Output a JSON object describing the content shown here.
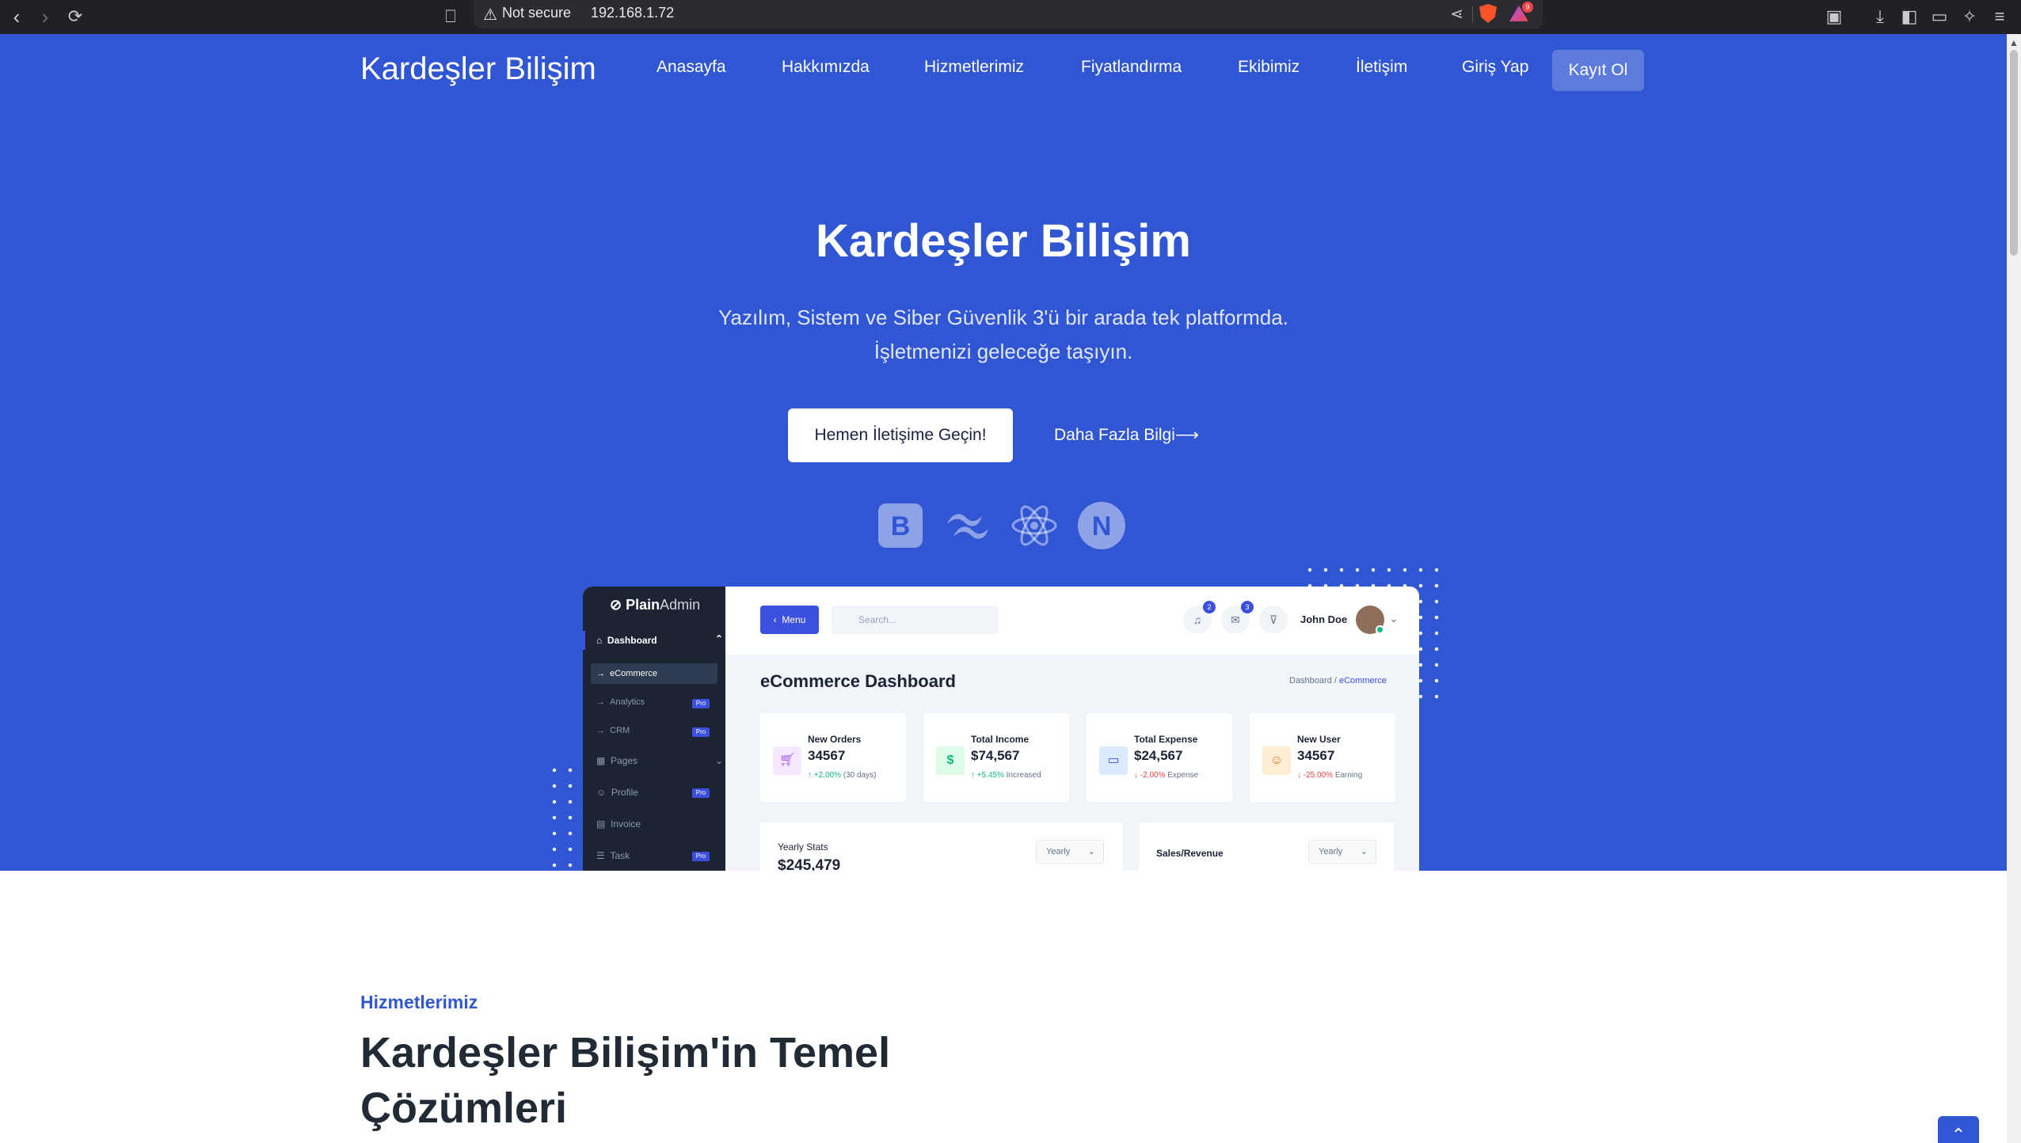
{
  "browser": {
    "security_label": "Not secure",
    "url": "192.168.1.72",
    "rewards_badge": "9"
  },
  "site": {
    "brand": "Kardeşler Bilişim",
    "nav": [
      {
        "label": "Anasayfa"
      },
      {
        "label": "Hakkımızda"
      },
      {
        "label": "Hizmetlerimiz"
      },
      {
        "label": "Fiyatlandırma"
      },
      {
        "label": "Ekibimiz"
      },
      {
        "label": "İletişim"
      },
      {
        "label": "Giriş Yap"
      },
      {
        "label": "Kayıt Ol"
      }
    ]
  },
  "hero": {
    "title": "Kardeşler Bilişim",
    "subtitle_line1": "Yazılım, Sistem ve Siber Güvenlik 3'ü bir arada tek platformda.",
    "subtitle_line2": "İşletmenizi geleceğe taşıyın.",
    "primary_cta": "Hemen İletişime Geçin!",
    "secondary_cta": "Daha Fazla Bilgi⟶",
    "tech_icons": [
      "bootstrap-icon",
      "tailwind-icon",
      "react-icon",
      "nextjs-icon"
    ]
  },
  "dashboard": {
    "logo_bold": "Plain",
    "logo_light": "Admin",
    "sidebar": [
      {
        "label": "Dashboard"
      },
      {
        "label": "eCommerce"
      },
      {
        "label": "Analytics",
        "badge": "Pro"
      },
      {
        "label": "CRM",
        "badge": "Pro"
      },
      {
        "label": "Pages"
      },
      {
        "label": "Profile",
        "badge": "Pro"
      },
      {
        "label": "Invoice"
      },
      {
        "label": "Task",
        "badge": "Pro"
      }
    ],
    "menu_button": "Menu",
    "search_placeholder": "Search...",
    "notif_count": "2",
    "message_count": "3",
    "user_name": "John Doe",
    "page_title": "eCommerce Dashboard",
    "breadcrumb_root": "Dashboard",
    "breadcrumb_current": "eCommerce",
    "cards": [
      {
        "label": "New Orders",
        "value": "34567",
        "change": "+2.00%",
        "note": "(30 days)",
        "trend": "up"
      },
      {
        "label": "Total Income",
        "value": "$74,567",
        "change": "+5.45%",
        "note": "Increased",
        "trend": "up"
      },
      {
        "label": "Total Expense",
        "value": "$24,567",
        "change": "-2.00%",
        "note": "Expense",
        "trend": "down"
      },
      {
        "label": "New User",
        "value": "34567",
        "change": "-25.00%",
        "note": "Earning",
        "trend": "down"
      }
    ],
    "yearly_stats_title": "Yearly Stats",
    "yearly_stats_value": "$245,479",
    "yearly_select": "Yearly",
    "sales_title": "Sales/Revenue",
    "sales_select": "Yearly"
  },
  "services": {
    "tag": "Hizmetlerimiz",
    "title_line1": "Kardeşler Bilişim'in Temel",
    "title_line2": "Çözümleri"
  },
  "colors": {
    "primary": "#3056d3",
    "dash_sidebar": "#1c2434",
    "dash_accent": "#3c50e0"
  }
}
